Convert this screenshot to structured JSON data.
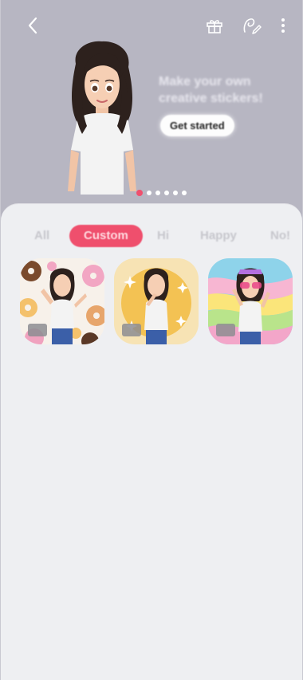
{
  "header": {
    "icons": [
      "back-icon",
      "gift-icon",
      "edit-sticker-icon",
      "more-options-icon"
    ]
  },
  "hero": {
    "promo_text": "Make your own creative stickers!",
    "cta_label": "Get started",
    "page_dots": {
      "count": 6,
      "active_index": 0
    }
  },
  "tabs": [
    {
      "label": "All"
    },
    {
      "label": "Custom",
      "selected": true
    },
    {
      "label": "Hi"
    },
    {
      "label": "Happy"
    },
    {
      "label": "No!"
    }
  ],
  "stickers": [
    {
      "name": "donut-sticker",
      "background": "donuts"
    },
    {
      "name": "sparkle-sticker",
      "background": "yellow-sparkles"
    },
    {
      "name": "rainbow-sticker",
      "background": "rainbow-swirl"
    }
  ],
  "colors": {
    "accent": "#ef4f6d",
    "hero_bg": "#b7b6c2",
    "sheet_bg": "#eeeff2"
  }
}
